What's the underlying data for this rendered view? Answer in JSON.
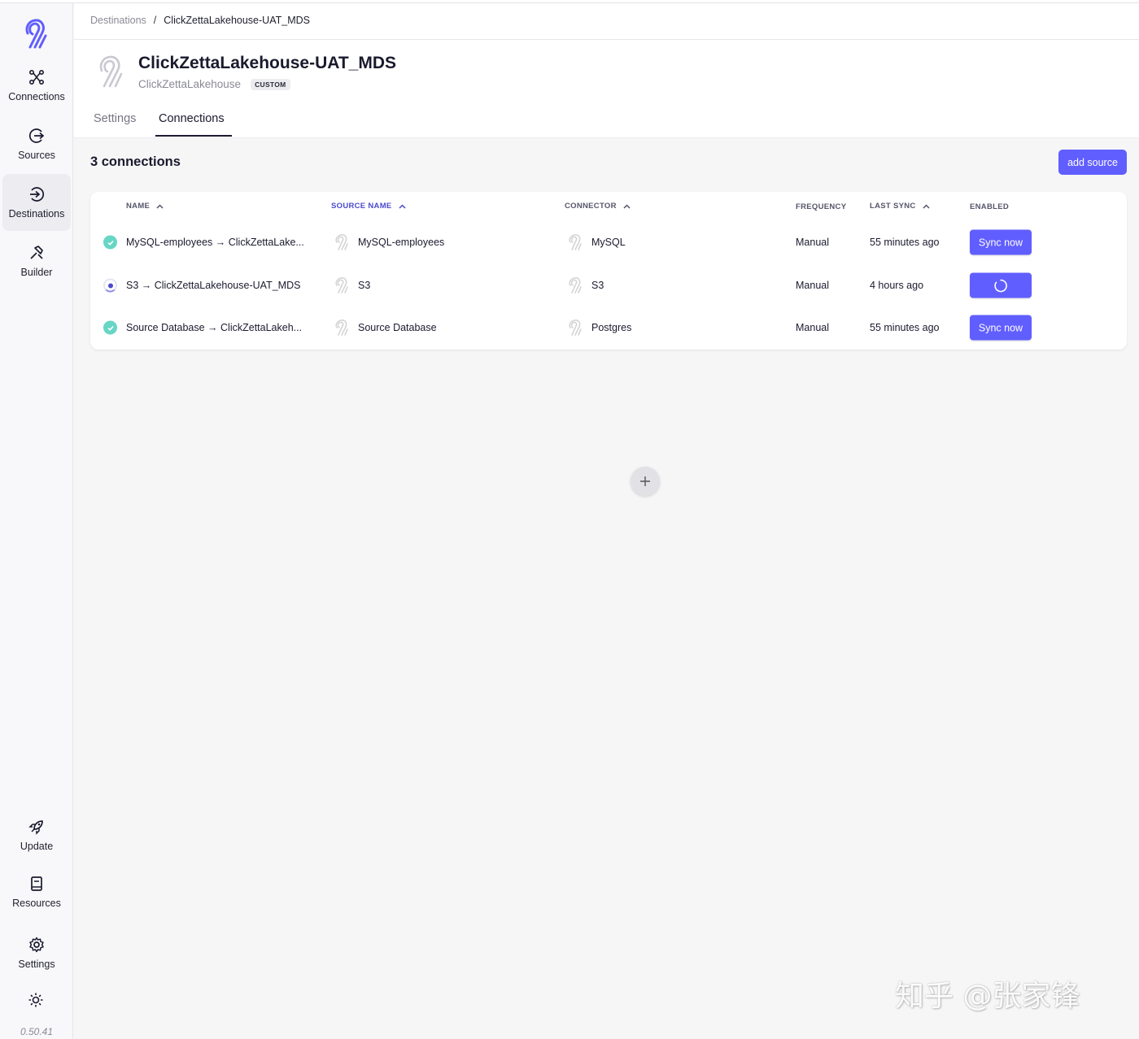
{
  "sidebar": {
    "items": [
      {
        "label": "Connections",
        "icon": "connections-icon"
      },
      {
        "label": "Sources",
        "icon": "sources-icon"
      },
      {
        "label": "Destinations",
        "icon": "destinations-icon"
      },
      {
        "label": "Builder",
        "icon": "builder-icon"
      }
    ],
    "bottom_items": [
      {
        "label": "Update",
        "icon": "rocket-icon"
      },
      {
        "label": "Resources",
        "icon": "book-icon"
      },
      {
        "label": "Settings",
        "icon": "gear-icon"
      }
    ],
    "version": "0.50.41",
    "active": "Destinations"
  },
  "breadcrumb": {
    "parent": "Destinations",
    "separator": "/",
    "current": "ClickZettaLakehouse-UAT_MDS"
  },
  "destination": {
    "title": "ClickZettaLakehouse-UAT_MDS",
    "subtitle": "ClickZettaLakehouse",
    "badge": "CUSTOM"
  },
  "tabs": [
    {
      "label": "Settings",
      "active": false
    },
    {
      "label": "Connections",
      "active": true
    }
  ],
  "main": {
    "count_title": "3 connections",
    "add_source_label": "add source"
  },
  "table": {
    "headers": {
      "name": "NAME",
      "source_name": "SOURCE NAME",
      "connector": "CONNECTOR",
      "frequency": "FREQUENCY",
      "last_sync": "LAST SYNC",
      "enabled": "ENABLED"
    },
    "rows": [
      {
        "status": "success",
        "name": "MySQL-employees → ClickZettaLake...",
        "source_name": "MySQL-employees",
        "connector": "MySQL",
        "frequency": "Manual",
        "last_sync": "55 minutes ago",
        "action": "Sync now"
      },
      {
        "status": "running",
        "name": "S3 → ClickZettaLakehouse-UAT_MDS",
        "source_name": "S3",
        "connector": "S3",
        "frequency": "Manual",
        "last_sync": "4 hours ago",
        "action": ""
      },
      {
        "status": "success",
        "name": "Source Database → ClickZettaLakeh...",
        "source_name": "Source Database",
        "connector": "Postgres",
        "frequency": "Manual",
        "last_sync": "55 minutes ago",
        "action": "Sync now"
      }
    ]
  },
  "colors": {
    "accent": "#615eff",
    "success": "#67d6c4",
    "sorted_header": "#4b4acf"
  },
  "watermark": "知乎 @张家锋"
}
